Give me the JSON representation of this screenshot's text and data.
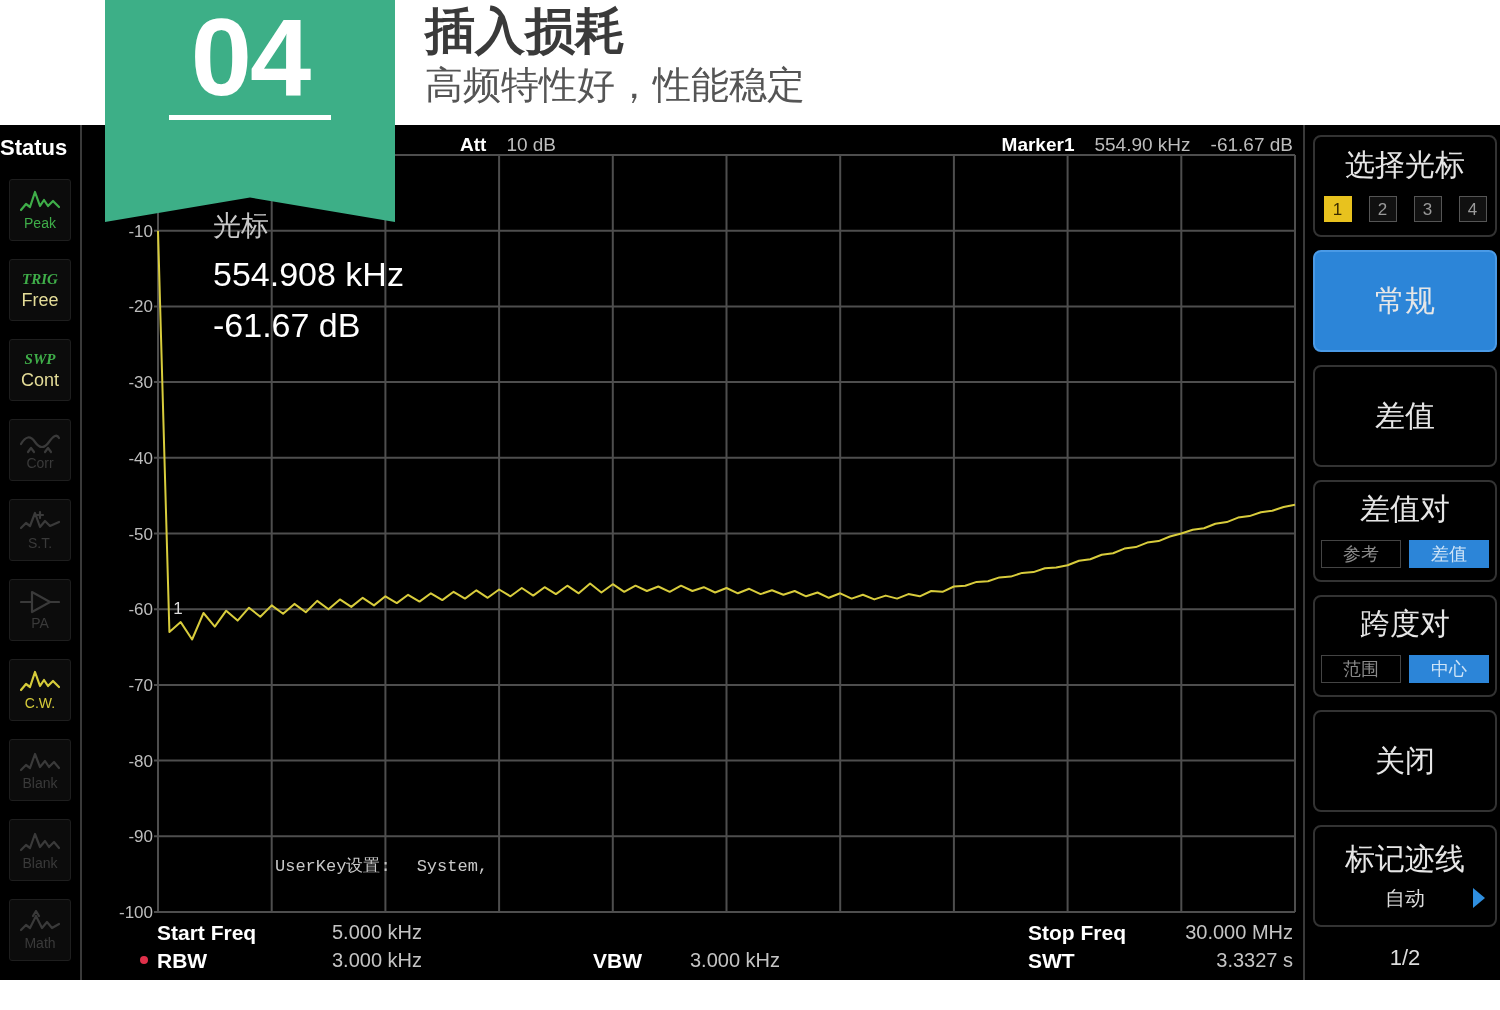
{
  "header": {
    "number": "04",
    "title": "插入损耗",
    "subtitle": "高频特性好，性能稳定"
  },
  "status": {
    "heading": "Status",
    "tiles": [
      {
        "kind": "peak",
        "label": "Peak",
        "active": true,
        "color": "#3fae49"
      },
      {
        "kind": "trig",
        "label": "TRIG",
        "value": "Free",
        "active": true,
        "color": "#3fae49"
      },
      {
        "kind": "swp",
        "label": "SWP",
        "value": "Cont",
        "active": true,
        "color": "#3fae49"
      },
      {
        "kind": "corr",
        "label": "Corr",
        "active": false
      },
      {
        "kind": "st",
        "label": "S.T.",
        "active": false
      },
      {
        "kind": "pa",
        "label": "PA",
        "active": false
      },
      {
        "kind": "cw",
        "label": "C.W.",
        "active": true,
        "color": "#d6cc3a"
      },
      {
        "kind": "blank",
        "label": "Blank",
        "active": false
      },
      {
        "kind": "blank",
        "label": "Blank",
        "active": false
      },
      {
        "kind": "math",
        "label": "Math",
        "active": false
      }
    ]
  },
  "top_bar": {
    "att": {
      "label": "Att",
      "value": "10 dB"
    },
    "marker": {
      "label": "Marker1",
      "frequency": "554.90 kHz",
      "amplitude": "-61.67 dB"
    }
  },
  "plot": {
    "readout": {
      "title": "光标",
      "frequency": "554.908 kHz",
      "amplitude": "-61.67 dB"
    },
    "marker_label": "1",
    "message": {
      "label": "UserKey设置:",
      "value": "System,"
    },
    "chart_data": {
      "type": "line",
      "grid": true,
      "ylim": [
        -100,
        0
      ],
      "yticks": [
        -10,
        -20,
        -30,
        -40,
        -50,
        -60,
        -70,
        -80,
        -90,
        -100
      ],
      "categories": [
        null,
        null,
        null,
        null,
        null,
        null,
        null,
        null,
        null,
        null,
        null,
        null,
        null,
        null,
        null,
        null,
        null,
        null,
        null,
        null,
        null,
        null,
        null,
        null,
        null,
        null,
        null,
        null,
        null,
        null,
        null,
        null,
        null,
        null,
        null,
        null,
        null,
        null,
        null,
        null,
        null,
        null,
        null,
        null,
        null,
        null,
        null,
        null,
        null,
        null,
        null,
        null,
        null,
        null,
        null,
        null,
        null,
        null,
        null,
        null,
        null,
        null,
        null,
        null,
        null,
        null,
        null,
        null,
        null,
        null,
        null,
        null,
        null,
        null,
        null,
        null,
        null,
        null,
        null,
        null,
        null,
        null,
        null,
        null,
        null,
        null,
        null,
        null,
        null,
        null,
        null,
        null,
        null,
        null,
        null,
        null,
        null,
        null,
        null,
        null,
        null
      ],
      "series": [
        {
          "color": "#d8cc3c",
          "values": [
            -10,
            -63,
            -61.7,
            -64,
            -60.5,
            -62.3,
            -60.2,
            -61.5,
            -59.8,
            -61,
            -59.5,
            -60.6,
            -59.3,
            -60.4,
            -58.9,
            -60,
            -58.7,
            -59.7,
            -58.5,
            -59.5,
            -58.3,
            -59.2,
            -58.1,
            -59,
            -57.9,
            -58.8,
            -57.7,
            -58.6,
            -57.5,
            -58.5,
            -57.4,
            -58.3,
            -57.2,
            -58.2,
            -57.1,
            -58,
            -56.9,
            -57.9,
            -56.6,
            -57.8,
            -56.7,
            -57.7,
            -56.9,
            -57.6,
            -57,
            -57.7,
            -56.9,
            -57.6,
            -57.1,
            -57.8,
            -57.2,
            -57.9,
            -57.3,
            -58,
            -57.5,
            -58.1,
            -57.6,
            -58.3,
            -57.8,
            -58.5,
            -57.9,
            -58.6,
            -58.1,
            -58.7,
            -58.2,
            -58.6,
            -58,
            -58.3,
            -57.6,
            -57.7,
            -57,
            -56.9,
            -56.4,
            -56.3,
            -55.8,
            -55.7,
            -55.2,
            -55.1,
            -54.6,
            -54.5,
            -54.2,
            -53.6,
            -53.4,
            -52.8,
            -52.6,
            -52,
            -51.8,
            -51.2,
            -51,
            -50.4,
            -50,
            -49.5,
            -49.3,
            -48.7,
            -48.5,
            -47.9,
            -47.7,
            -47.2,
            -47,
            -46.5,
            -46.2
          ]
        }
      ]
    }
  },
  "footer": {
    "start_freq": {
      "label": "Start Freq",
      "value": "5.000 kHz",
      "flagged": false
    },
    "stop_freq": {
      "label": "Stop Freq",
      "value": "30.000 MHz",
      "flagged": false
    },
    "rbw": {
      "label": "RBW",
      "value": "3.000 kHz",
      "flagged": true
    },
    "vbw": {
      "label": "VBW",
      "value": "3.000 kHz",
      "flagged": false
    },
    "swt": {
      "label": "SWT",
      "value": "3.3327 s",
      "flagged": false
    }
  },
  "softkeys": [
    {
      "kind": "marker_select",
      "label": "选择光标",
      "selected": false,
      "options": [
        {
          "label": "1",
          "selected": true
        },
        {
          "label": "2",
          "selected": false
        },
        {
          "label": "3",
          "selected": false
        },
        {
          "label": "4",
          "selected": false
        }
      ]
    },
    {
      "kind": "plain",
      "label": "常规",
      "selected": true
    },
    {
      "kind": "plain",
      "label": "差值",
      "selected": false
    },
    {
      "kind": "toggle",
      "label": "差值对",
      "selected": false,
      "options": [
        {
          "label": "参考",
          "selected": false
        },
        {
          "label": "差值",
          "selected": true
        }
      ]
    },
    {
      "kind": "toggle",
      "label": "跨度对",
      "selected": false,
      "options": [
        {
          "label": "范围",
          "selected": false
        },
        {
          "label": "中心",
          "selected": true
        }
      ]
    },
    {
      "kind": "plain",
      "label": "关闭",
      "selected": false
    },
    {
      "kind": "submenu",
      "label": "标记迹线",
      "value": "自动",
      "selected": false
    }
  ],
  "page_indicator": "1/2"
}
